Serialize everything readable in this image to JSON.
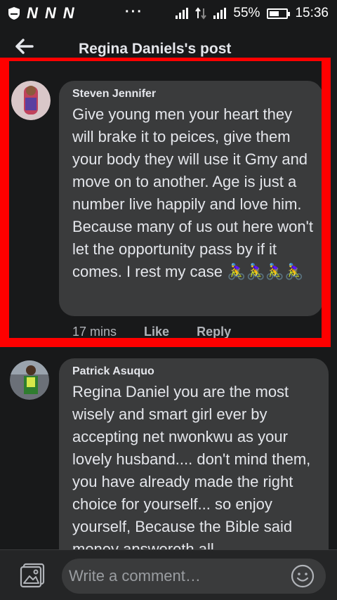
{
  "status_bar": {
    "notif_icons": [
      "N",
      "N",
      "N"
    ],
    "overflow": "···",
    "battery_text": "55%",
    "battery_level": 0.55,
    "time": "15:36"
  },
  "header": {
    "title": "Regina Daniels's post"
  },
  "comments": [
    {
      "author": "Steven Jennifer",
      "text": "Give young men your heart they will brake it to peices, give them your body they will use it Gmy and move on to another. Age is just a number live happily and love him. Because many of us out here won't let the opportunity pass by if it comes. I rest my case 🚴‍♀️🚴‍♀️🚴‍♀️🚴‍♀️",
      "time": "17 mins",
      "like": "Like",
      "reply": "Reply"
    },
    {
      "author": "Patrick Asuquo",
      "text": "Regina Daniel you are the most wisely and smart girl ever by accepting net nwonkwu as your lovely husband.... don't mind them, you have already made the right choice for yourself... so enjoy yourself, Because the Bible said money answereth all"
    }
  ],
  "composer": {
    "placeholder": "Write a comment…"
  },
  "colors": {
    "background": "#18191a",
    "bubble": "#3a3b3c",
    "highlight": "#ff0000"
  }
}
